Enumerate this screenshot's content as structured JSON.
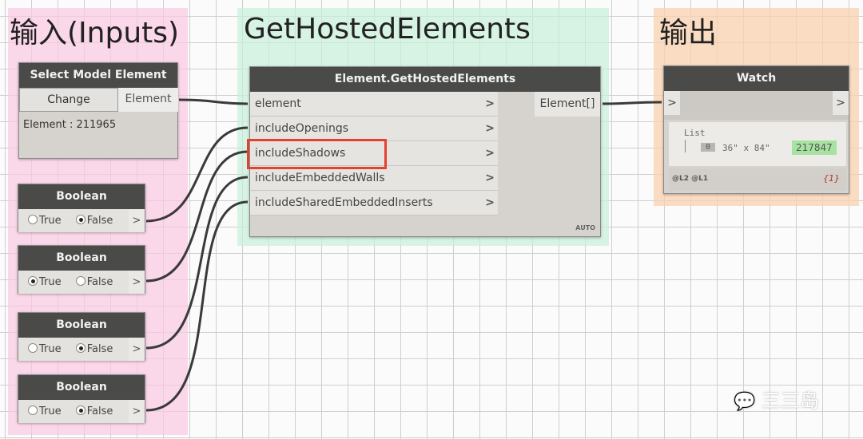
{
  "zones": {
    "inputs": "输入(Inputs)",
    "main": "GetHostedElements",
    "outputs": "输出"
  },
  "select_node": {
    "title": "Select Model Element",
    "change_label": "Change",
    "output": "Element",
    "value": "Element : 211965"
  },
  "boolean_nodes": [
    {
      "title": "Boolean",
      "true_label": "True",
      "false_label": "False",
      "selected": "False",
      "out": ">"
    },
    {
      "title": "Boolean",
      "true_label": "True",
      "false_label": "False",
      "selected": "True",
      "out": ">"
    },
    {
      "title": "Boolean",
      "true_label": "True",
      "false_label": "False",
      "selected": "False",
      "out": ">"
    },
    {
      "title": "Boolean",
      "true_label": "True",
      "false_label": "False",
      "selected": "False",
      "out": ">"
    }
  ],
  "main_node": {
    "title": "Element.GetHostedElements",
    "inputs": [
      "element",
      "includeOpenings",
      "includeShadows",
      "includeEmbeddedWalls",
      "includeSharedEmbeddedInserts"
    ],
    "output": "Element[]",
    "lacing": "AUTO",
    "highlighted_input": "includeShadows"
  },
  "watch_node": {
    "title": "Watch",
    "in": ">",
    "out": ">",
    "list_label": "List",
    "index": "0",
    "item_text": "36\" x 84\"",
    "item_id": "217847",
    "levels": "@L2 @L1",
    "count": "{1}"
  },
  "watermark": "三三岛",
  "colors": {
    "inputs_zone": "#f9d3e6",
    "main_zone": "#d5f3e3",
    "outputs_zone": "#fbd9bd",
    "highlight": "#e4412f",
    "id_badge": "#a7e3a0"
  }
}
